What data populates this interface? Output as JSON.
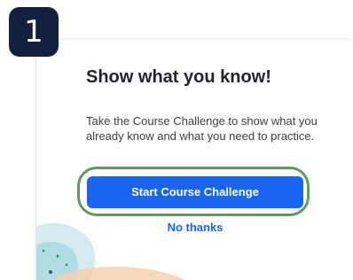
{
  "step": {
    "number": "1",
    "badge_color": "#14203f"
  },
  "dialog": {
    "title": "Show what you know!",
    "description": "Take the Course Challenge to show what you already know and what you need to practice.",
    "primary_button_label": "Start Course Challenge",
    "secondary_link_label": "No thanks"
  },
  "colors": {
    "primary": "#1865f2",
    "highlight_ring": "#5e9b63",
    "title_text": "#21242c",
    "body_text": "#3b3e40"
  }
}
